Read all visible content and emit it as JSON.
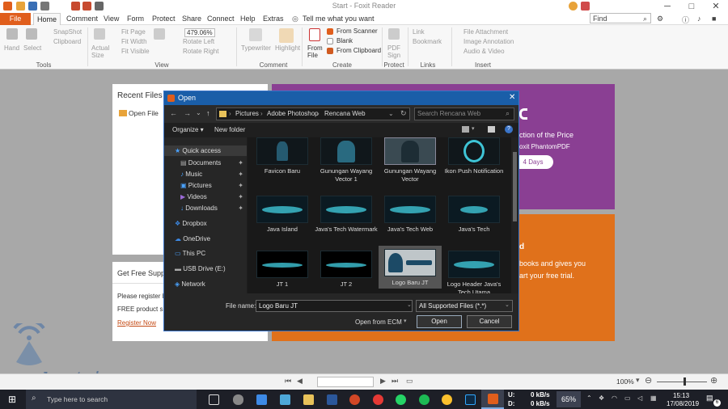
{
  "app": {
    "title": "Start - Foxit Reader"
  },
  "menu": [
    "File",
    "Home",
    "Comment",
    "View",
    "Form",
    "Protect",
    "Share",
    "Connect",
    "Help",
    "Extras"
  ],
  "tell_me": "Tell me what you want",
  "find_placeholder": "Find",
  "ribbon": {
    "tools": {
      "hand": "Hand",
      "select": "Select",
      "snapshot": "SnapShot",
      "clipboard": "Clipboard",
      "label": "Tools"
    },
    "view": {
      "actual": "Actual Size",
      "fit_page": "Fit Page",
      "fit_width": "Fit Width",
      "fit_visible": "Fit Visible",
      "zoom": "479.06%",
      "rotate_left": "Rotate Left",
      "rotate_right": "Rotate Right",
      "label": "View"
    },
    "comment": {
      "typewriter": "Typewriter",
      "highlight": "Highlight",
      "label": "Comment"
    },
    "create": {
      "from_file": "From File",
      "from_scanner": "From Scanner",
      "blank": "Blank",
      "from_clipboard": "From Clipboard",
      "label": "Create"
    },
    "protect": {
      "pdf_sign": "PDF Sign",
      "label": "Protect"
    },
    "links": {
      "link": "Link",
      "bookmark": "Bookmark",
      "label": "Links"
    },
    "insert": {
      "file_attachment": "File Attachment",
      "image_annotation": "Image Annotation",
      "audio_video": "Audio & Video",
      "label": "Insert"
    }
  },
  "start": {
    "recent_files": "Recent Files",
    "open_file": "Open File",
    "get_free": "Get Free Supp",
    "please_register": "Please register b",
    "free_product": "FREE product su",
    "register_now": "Register Now",
    "promo1_line1": "ction of the Price",
    "promo1_line2": "oxit PhantomPDF",
    "promo1_btn": "4 Days",
    "promo2_line1": "books and gives you",
    "promo2_line2": "art your free trial."
  },
  "dialog": {
    "title": "Open",
    "breadcrumb": [
      "Pictures",
      "Adobe Photoshop",
      "Rencana Web"
    ],
    "search_placeholder": "Search Rencana Web",
    "organize": "Organize ▾",
    "new_folder": "New folder",
    "sidebar": [
      "Quick access",
      "Documents",
      "Music",
      "Pictures",
      "Videos",
      "Downloads",
      "Dropbox",
      "OneDrive",
      "This PC",
      "USB Drive (E:)",
      "Network"
    ],
    "files": [
      "Favicon Baru",
      "Gunungan Wayang Vector 1",
      "Gunungan Wayang Vector",
      "Ikon Push Notification",
      "Java Island",
      "Java's Tech Watermark",
      "Java's Tech Web",
      "Java's Tech",
      "JT 1",
      "JT 2",
      "Logo Baru JT",
      "Logo Header Java's Tech Utama"
    ],
    "file_name_label": "File name:",
    "file_name_value": "Logo Baru JT",
    "file_type": "All Supported Files (*.*)",
    "open_from_ecm": "Open from ECM",
    "open_btn": "Open",
    "cancel_btn": "Cancel"
  },
  "status": {
    "zoom": "100%"
  },
  "watermark": "Javastech.com",
  "taskbar": {
    "search": "Type here to search",
    "net_u": "U:",
    "net_d": "D:",
    "net_u_val": "0 kB/s",
    "net_d_val": "0 kB/s",
    "battery": "65%",
    "time": "15:13",
    "date": "17/08/2019",
    "notif": "6"
  },
  "colors": {
    "foxit_orange": "#e05e1c",
    "dialog_blue": "#1a5ea8",
    "promo_purple": "#8a3f93",
    "promo_orange": "#e0711b"
  }
}
